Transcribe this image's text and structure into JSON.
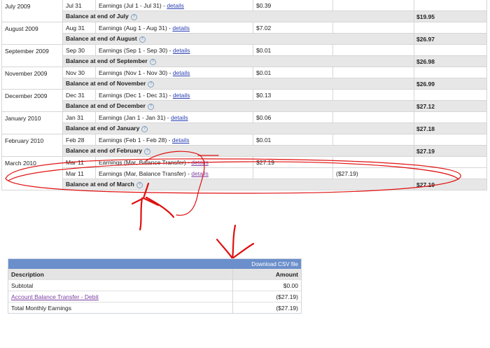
{
  "history": [
    {
      "month": "July 2009",
      "rows": [
        {
          "date": "Jul 31",
          "desc": "Earnings (Jul 1 - Jul 31) -",
          "link": "details",
          "amount": "$0.39",
          "debit": ""
        }
      ],
      "balance_label": "Balance at end of July",
      "balance": "$19.95"
    },
    {
      "month": "August 2009",
      "rows": [
        {
          "date": "Aug 31",
          "desc": "Earnings (Aug 1 - Aug 31) -",
          "link": "details",
          "amount": "$7.02",
          "debit": ""
        }
      ],
      "balance_label": "Balance at end of August",
      "balance": "$26.97"
    },
    {
      "month": "September 2009",
      "rows": [
        {
          "date": "Sep 30",
          "desc": "Earnings (Sep 1 - Sep 30) -",
          "link": "details",
          "amount": "$0.01",
          "debit": ""
        }
      ],
      "balance_label": "Balance at end of September",
      "balance": "$26.98"
    },
    {
      "month": "November 2009",
      "rows": [
        {
          "date": "Nov 30",
          "desc": "Earnings (Nov 1 - Nov 30) -",
          "link": "details",
          "amount": "$0.01",
          "debit": ""
        }
      ],
      "balance_label": "Balance at end of November",
      "balance": "$26.99"
    },
    {
      "month": "December 2009",
      "rows": [
        {
          "date": "Dec 31",
          "desc": "Earnings (Dec 1 - Dec 31) -",
          "link": "details",
          "amount": "$0.13",
          "debit": ""
        }
      ],
      "balance_label": "Balance at end of December",
      "balance": "$27.12"
    },
    {
      "month": "January 2010",
      "rows": [
        {
          "date": "Jan 31",
          "desc": "Earnings (Jan 1 - Jan 31) -",
          "link": "details",
          "amount": "$0.06",
          "debit": ""
        }
      ],
      "balance_label": "Balance at end of January",
      "balance": "$27.18"
    },
    {
      "month": "February 2010",
      "rows": [
        {
          "date": "Feb 28",
          "desc": "Earnings (Feb 1 - Feb 28) -",
          "link": "details",
          "amount": "$0.01",
          "debit": ""
        }
      ],
      "balance_label": "Balance at end of February",
      "balance": "$27.19"
    },
    {
      "month": "March 2010",
      "rows": [
        {
          "date": "Mar 11",
          "desc": "Earnings (Mar, Balance Transfer) -",
          "link": "details",
          "amount": "$27.19",
          "debit": ""
        },
        {
          "date": "Mar 11",
          "desc": "Earnings (Mar, Balance Transfer) -",
          "link": "details",
          "amount": "",
          "debit": "($27.19)"
        }
      ],
      "balance_label": "Balance at end of March",
      "balance": "$27.19"
    }
  ],
  "help_icon": "question-circle-icon",
  "summary": {
    "download_label": "Download CSV file",
    "headers": {
      "description": "Description",
      "amount": "Amount"
    },
    "rows": [
      {
        "description": "Subtotal",
        "amount": "$0.00",
        "is_link": false
      },
      {
        "description": "Account Balance Transfer - Debit",
        "amount": "($27.19)",
        "is_link": true
      },
      {
        "description": "Total Monthly Earnings",
        "amount": "($27.19)",
        "is_link": false
      }
    ]
  },
  "colors": {
    "annotation": "#e01010",
    "summary_bar": "#6b8fcb",
    "balance_row": "#e7e7e7"
  }
}
